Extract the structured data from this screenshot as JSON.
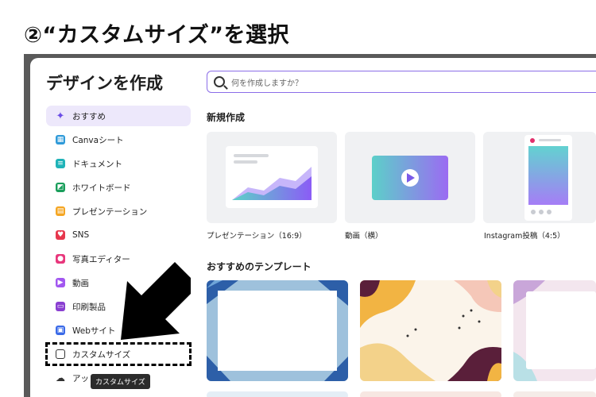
{
  "step_title": "②“カスタムサイズ”を選択",
  "panel_title": "デザインを作成",
  "search": {
    "placeholder": "何を作成しますか？"
  },
  "sidebar": {
    "items": [
      {
        "label": "おすすめ",
        "icon": "sparkle-icon"
      },
      {
        "label": "Canvaシート",
        "icon": "sheet-icon"
      },
      {
        "label": "ドキュメント",
        "icon": "document-icon"
      },
      {
        "label": "ホワイトボード",
        "icon": "whiteboard-icon"
      },
      {
        "label": "プレゼンテーション",
        "icon": "presentation-icon"
      },
      {
        "label": "SNS",
        "icon": "sns-icon"
      },
      {
        "label": "写真エディター",
        "icon": "photo-editor-icon"
      },
      {
        "label": "動画",
        "icon": "video-icon"
      },
      {
        "label": "印刷製品",
        "icon": "print-icon"
      },
      {
        "label": "Webサイト",
        "icon": "website-icon"
      },
      {
        "label": "カスタムサイズ",
        "icon": "custom-size-icon"
      },
      {
        "label": "アッ",
        "icon": "upload-icon"
      }
    ]
  },
  "tooltip": "カスタムサイズ",
  "new_section": {
    "title": "新規作成",
    "cards": [
      {
        "label": "プレゼンテーション（16:9）"
      },
      {
        "label": "動画（横）"
      },
      {
        "label": "Instagram投稿（4:5）"
      }
    ]
  },
  "templates_section": {
    "title": "おすすめのテンプレート"
  },
  "colors": {
    "accent": "#8b6de8",
    "active_bg": "#ede8fb"
  }
}
